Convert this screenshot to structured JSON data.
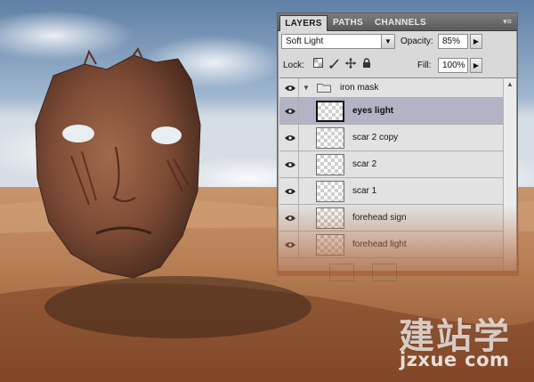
{
  "panel": {
    "tabs": [
      {
        "label": "LAYERS",
        "active": true
      },
      {
        "label": "PATHS",
        "active": false
      },
      {
        "label": "CHANNELS",
        "active": false
      }
    ],
    "menu_icon": "panel-menu-icon",
    "blend_mode": "Soft Light",
    "opacity_label": "Opacity:",
    "opacity_value": "85%",
    "lock_label": "Lock:",
    "lock_icons": [
      "lock-transparent-icon",
      "lock-paint-icon",
      "lock-move-icon",
      "lock-all-icon"
    ],
    "fill_label": "Fill:",
    "fill_value": "100%"
  },
  "layers": {
    "group_name": "iron mask",
    "items": [
      {
        "name": "eyes light",
        "selected": true,
        "visible": true
      },
      {
        "name": "scar 2 copy",
        "selected": false,
        "visible": true
      },
      {
        "name": "scar 2",
        "selected": false,
        "visible": true
      },
      {
        "name": "scar 1",
        "selected": false,
        "visible": true
      },
      {
        "name": "forehead sign",
        "selected": false,
        "visible": true
      },
      {
        "name": "forehead light",
        "selected": false,
        "visible": true
      }
    ]
  },
  "watermark": {
    "chinese": "建站学",
    "url_main": "jzxue",
    "url_dot": ".",
    "url_tail": "com",
    "tld_small": "cn"
  },
  "colors": {
    "selected_row": "#b2b3c4",
    "sky": "#6f8fb3",
    "sand": "#b47a4e",
    "watermark_accent": "#c62828"
  }
}
